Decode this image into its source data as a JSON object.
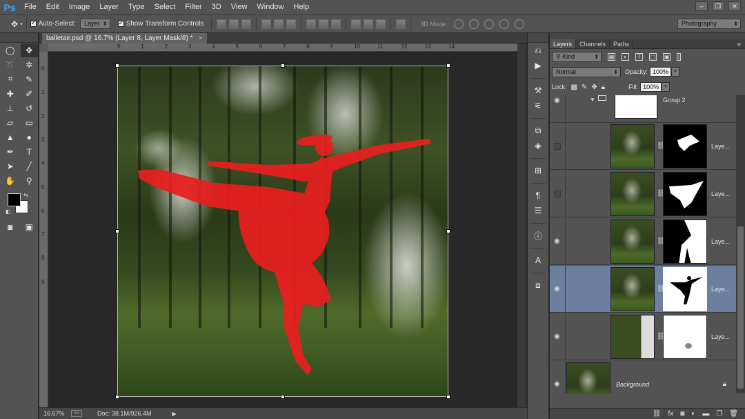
{
  "app": {
    "logo": "Ps"
  },
  "menu": [
    "File",
    "Edit",
    "Image",
    "Layer",
    "Type",
    "Select",
    "Filter",
    "3D",
    "View",
    "Window",
    "Help"
  ],
  "window_controls": {
    "minimize": "–",
    "restore": "❐",
    "close": "✕"
  },
  "options": {
    "auto_select_label": "Auto-Select:",
    "auto_select_value": "Layer",
    "show_transform_label": "Show Transform Controls",
    "mode_3d_label": "3D Mode:",
    "workspace": "Photography"
  },
  "document": {
    "tab_title": "balletair.psd @ 16.7% (Layer 8, Layer Mask/8) *",
    "close_glyph": "×",
    "ruler_h": [
      "0",
      "1",
      "2",
      "3",
      "4",
      "5",
      "6",
      "7",
      "8",
      "9",
      "10",
      "11",
      "12",
      "13",
      "14"
    ],
    "ruler_v": [
      "0",
      "1",
      "2",
      "3",
      "4",
      "5",
      "6",
      "7",
      "8",
      "9"
    ]
  },
  "status": {
    "zoom": "16.67%",
    "doc_info": "Doc: 38.1M/926.4M",
    "arrow": "▶"
  },
  "layers_panel": {
    "tabs": [
      "Layers",
      "Channels",
      "Paths"
    ],
    "menu_glyph": "≡",
    "kind_filter": "Kind",
    "blend_mode": "Normal",
    "opacity_label": "Opacity:",
    "opacity_value": "100%",
    "lock_label": "Lock:",
    "fill_label": "Fill:",
    "fill_value": "100%",
    "group_name": "Group 2",
    "layers": [
      {
        "name": "Laye...",
        "visible": false,
        "selected": false
      },
      {
        "name": "Laye...",
        "visible": false,
        "selected": false
      },
      {
        "name": "Laye...",
        "visible": true,
        "selected": false
      },
      {
        "name": "Laye...",
        "visible": true,
        "selected": true
      },
      {
        "name": "Laye...",
        "visible": true,
        "selected": false
      }
    ],
    "background_name": "Background",
    "footer_icons": [
      "link-icon",
      "fx-icon",
      "mask-icon",
      "adjustment-icon",
      "folder-icon",
      "new-layer-icon",
      "trash-icon"
    ]
  },
  "colors": {
    "foreground": "#000000",
    "background": "#ffffff",
    "selection": "#6c7f9f",
    "dancer_red": "#e81f1f"
  }
}
